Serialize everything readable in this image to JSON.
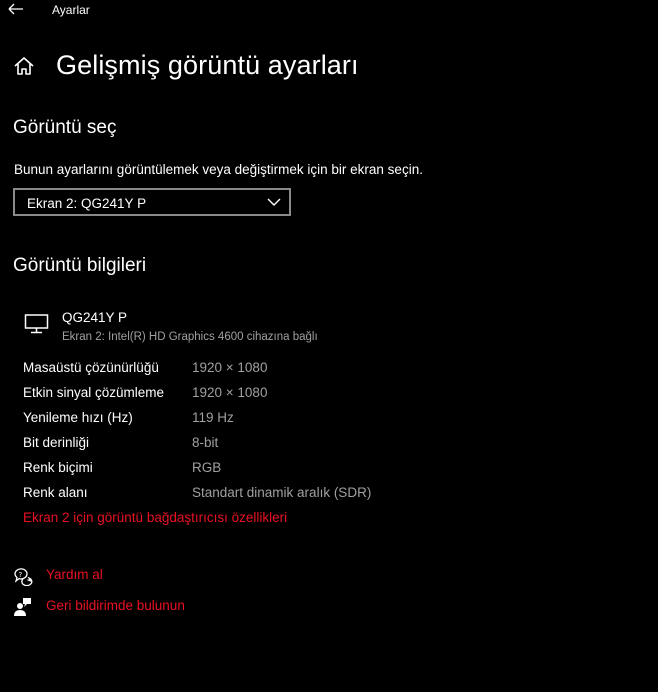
{
  "window": {
    "app_title": "Ayarlar"
  },
  "page": {
    "title": "Gelişmiş görüntü ayarları"
  },
  "select_display": {
    "heading": "Görüntü seç",
    "description": "Bunun ayarlarını görüntülemek veya değiştirmek için bir ekran seçin.",
    "selected": "Ekran 2: QG241Y P"
  },
  "display_info": {
    "heading": "Görüntü bilgileri",
    "monitor_name": "QG241Y P",
    "monitor_sub": "Ekran 2: Intel(R) HD Graphics 4600 cihazına bağlı",
    "rows": [
      {
        "label": "Masaüstü çözünürlüğü",
        "value": "1920 × 1080"
      },
      {
        "label": "Etkin sinyal çözümleme",
        "value": "1920 × 1080"
      },
      {
        "label": "Yenileme hızı (Hz)",
        "value": "119 Hz"
      },
      {
        "label": "Bit derinliği",
        "value": "8-bit"
      },
      {
        "label": "Renk biçimi",
        "value": "RGB"
      },
      {
        "label": "Renk alanı",
        "value": "Standart dinamik aralık (SDR)"
      }
    ],
    "adapter_link": "Ekran 2 için görüntü bağdaştırıcısı özellikleri"
  },
  "help": {
    "get_help": "Yardım al",
    "feedback": "Geri bildirimde bulunun"
  },
  "icons": {
    "back": "back-arrow-icon",
    "home": "home-icon",
    "monitor": "monitor-icon",
    "chevron": "chevron-down-icon",
    "help": "help-chat-icon",
    "feedback": "feedback-person-icon"
  },
  "colors": {
    "background": "#000000",
    "accent_link": "#e81123",
    "secondary_text": "#a0a0a0",
    "dropdown_border": "#8a8a8a"
  }
}
